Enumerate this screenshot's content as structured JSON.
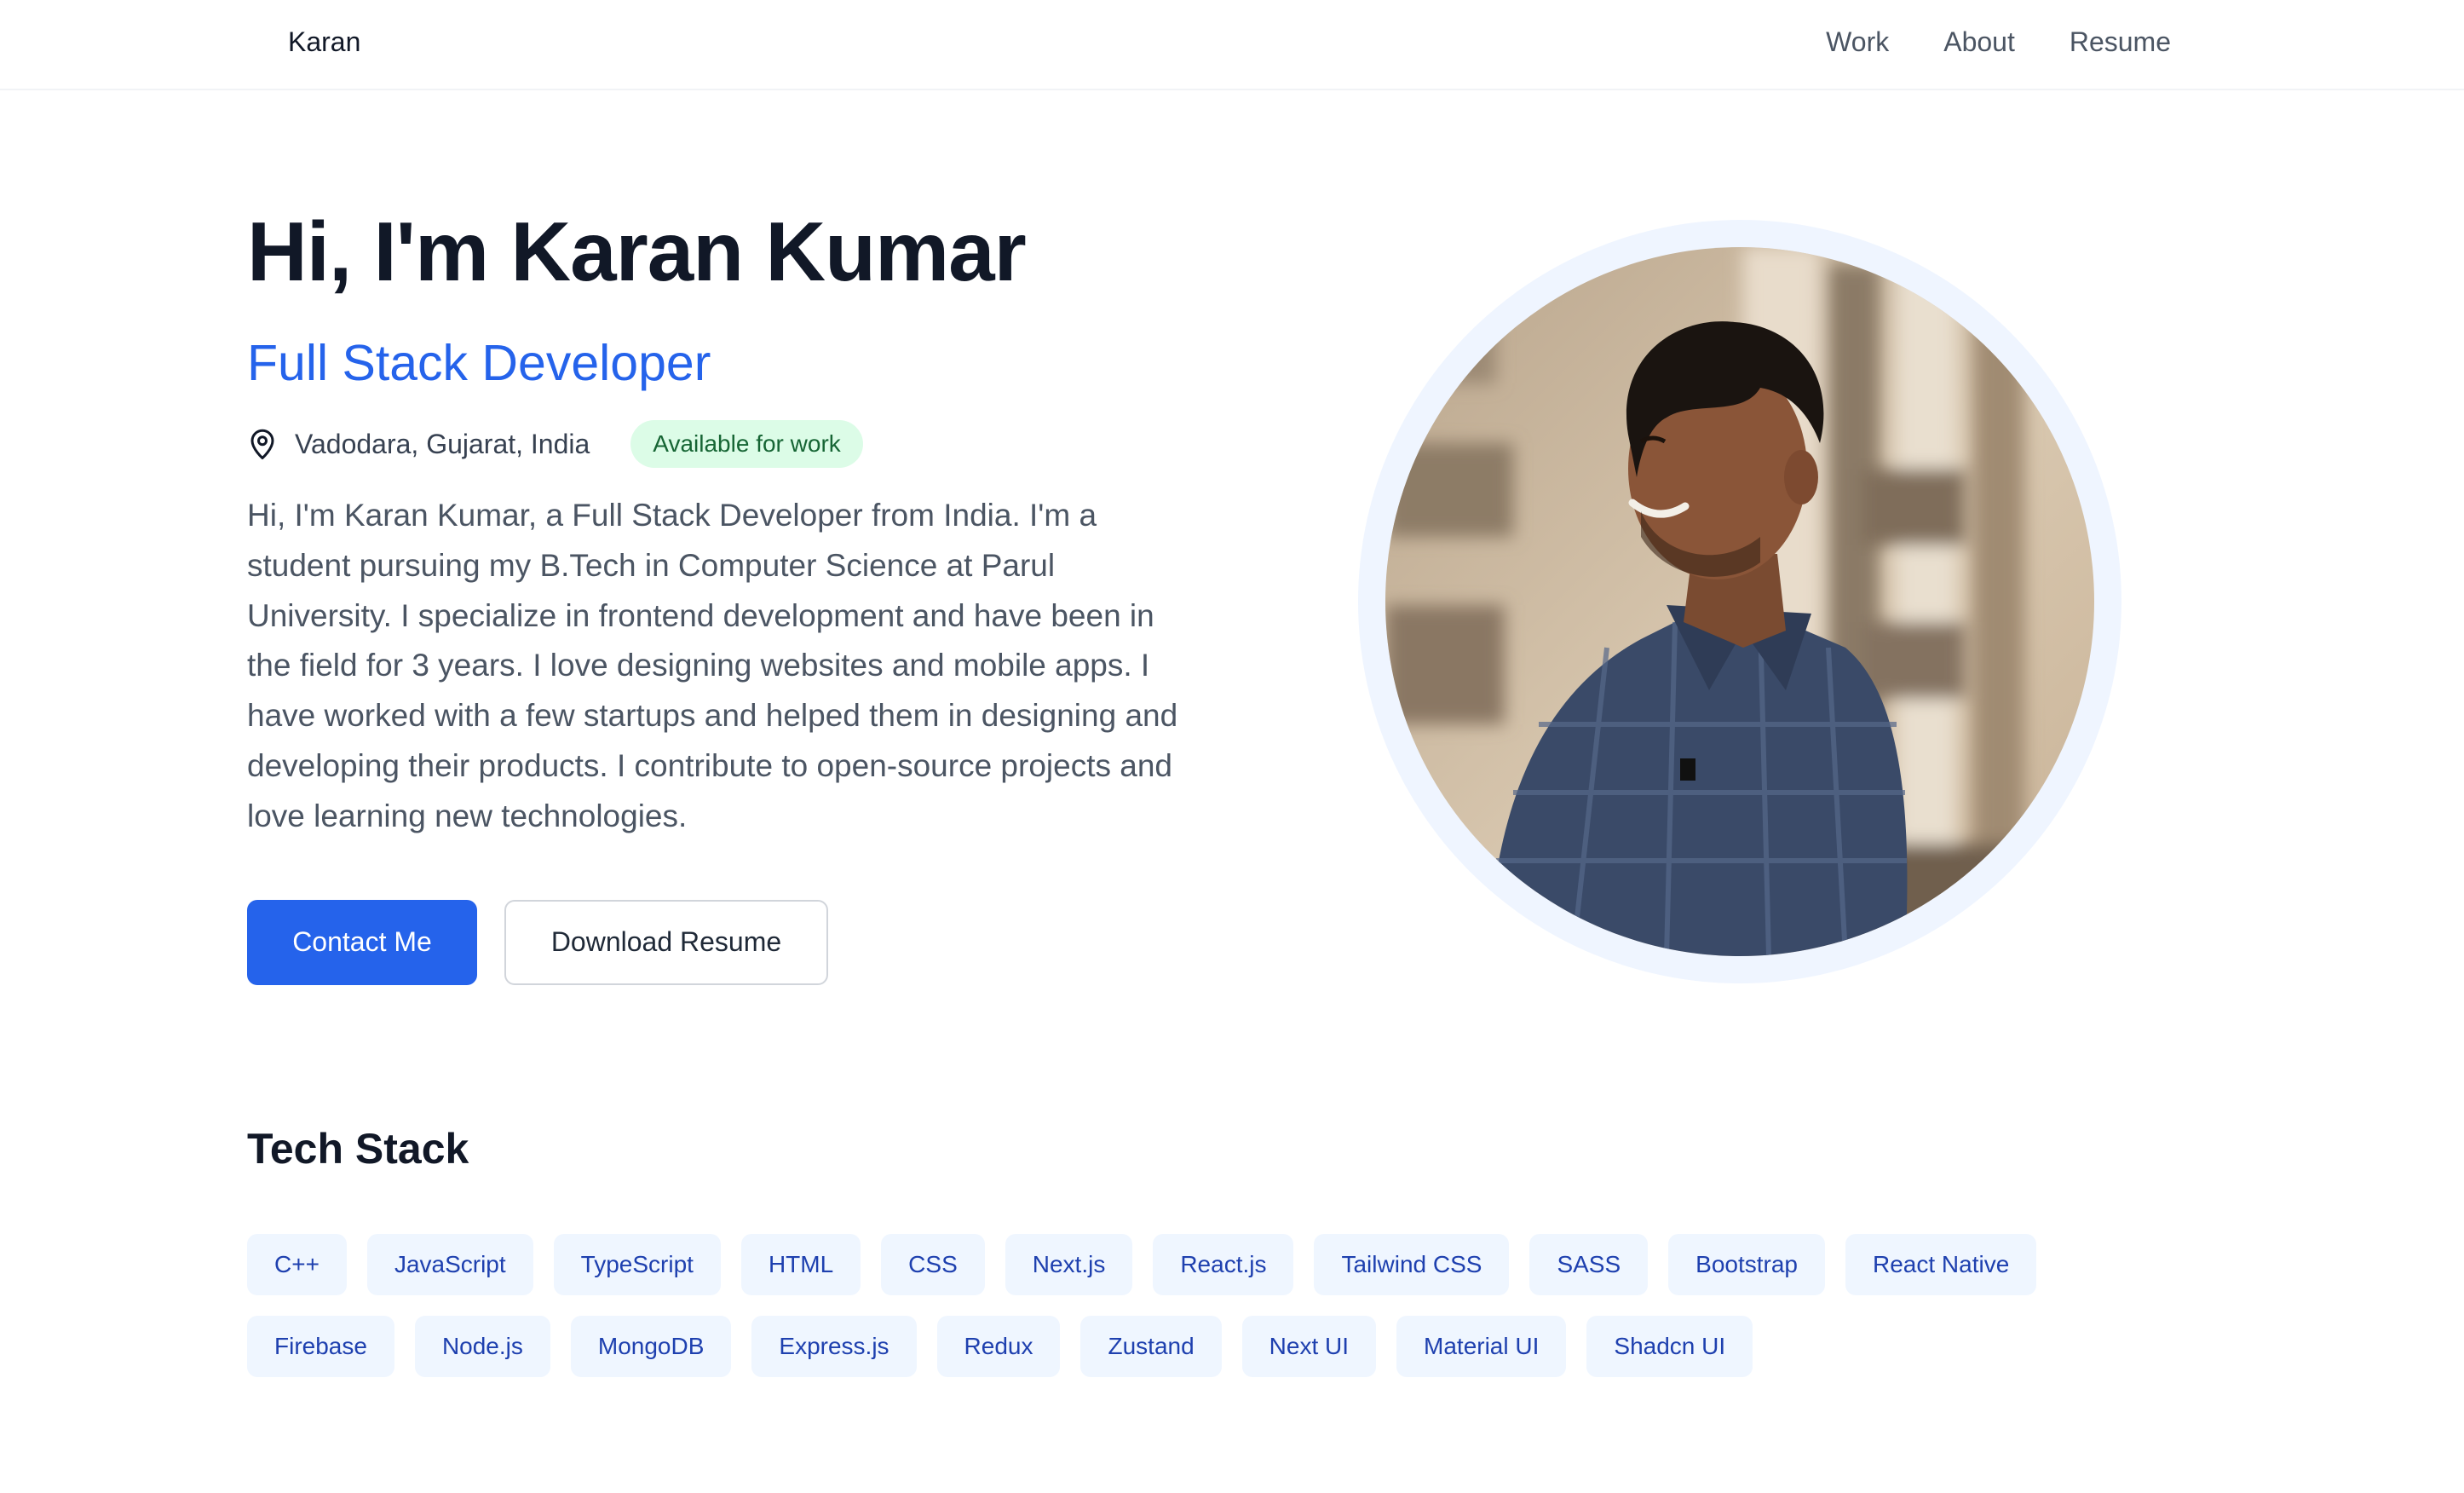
{
  "header": {
    "brand": "Karan",
    "nav": [
      {
        "label": "Work"
      },
      {
        "label": "About"
      },
      {
        "label": "Resume"
      }
    ]
  },
  "hero": {
    "title": "Hi, I'm Karan Kumar",
    "role": "Full Stack Developer",
    "location_icon": "map-pin-icon",
    "location": "Vadodara, Gujarat, India",
    "status": "Available for work",
    "bio": "Hi, I'm Karan Kumar, a Full Stack Developer from India. I'm a student pursuing my B.Tech in Computer Science at Parul University. I specialize in frontend development and have been in the field for 3 years. I love designing websites and mobile apps. I have worked with a few startups and helped them in designing and developing their products. I contribute to open-source projects and love learning new technologies.",
    "primary_button": "Contact Me",
    "secondary_button": "Download Resume"
  },
  "tech_stack": {
    "title": "Tech Stack",
    "row1": [
      "C++",
      "JavaScript",
      "TypeScript",
      "HTML",
      "CSS",
      "Next.js",
      "React.js",
      "Tailwind CSS",
      "SASS",
      "Bootstrap",
      "React Native"
    ],
    "row2": [
      "Firebase",
      "Node.js",
      "MongoDB",
      "Express.js",
      "Redux",
      "Zustand",
      "Next UI",
      "Material UI",
      "Shadcn UI"
    ]
  },
  "colors": {
    "accent": "#2563eb",
    "badge_bg": "#dcfce7",
    "badge_text": "#166534",
    "chip_bg": "#eff6ff",
    "chip_text": "#1e40af",
    "portrait_ring": "#eff5ff"
  }
}
